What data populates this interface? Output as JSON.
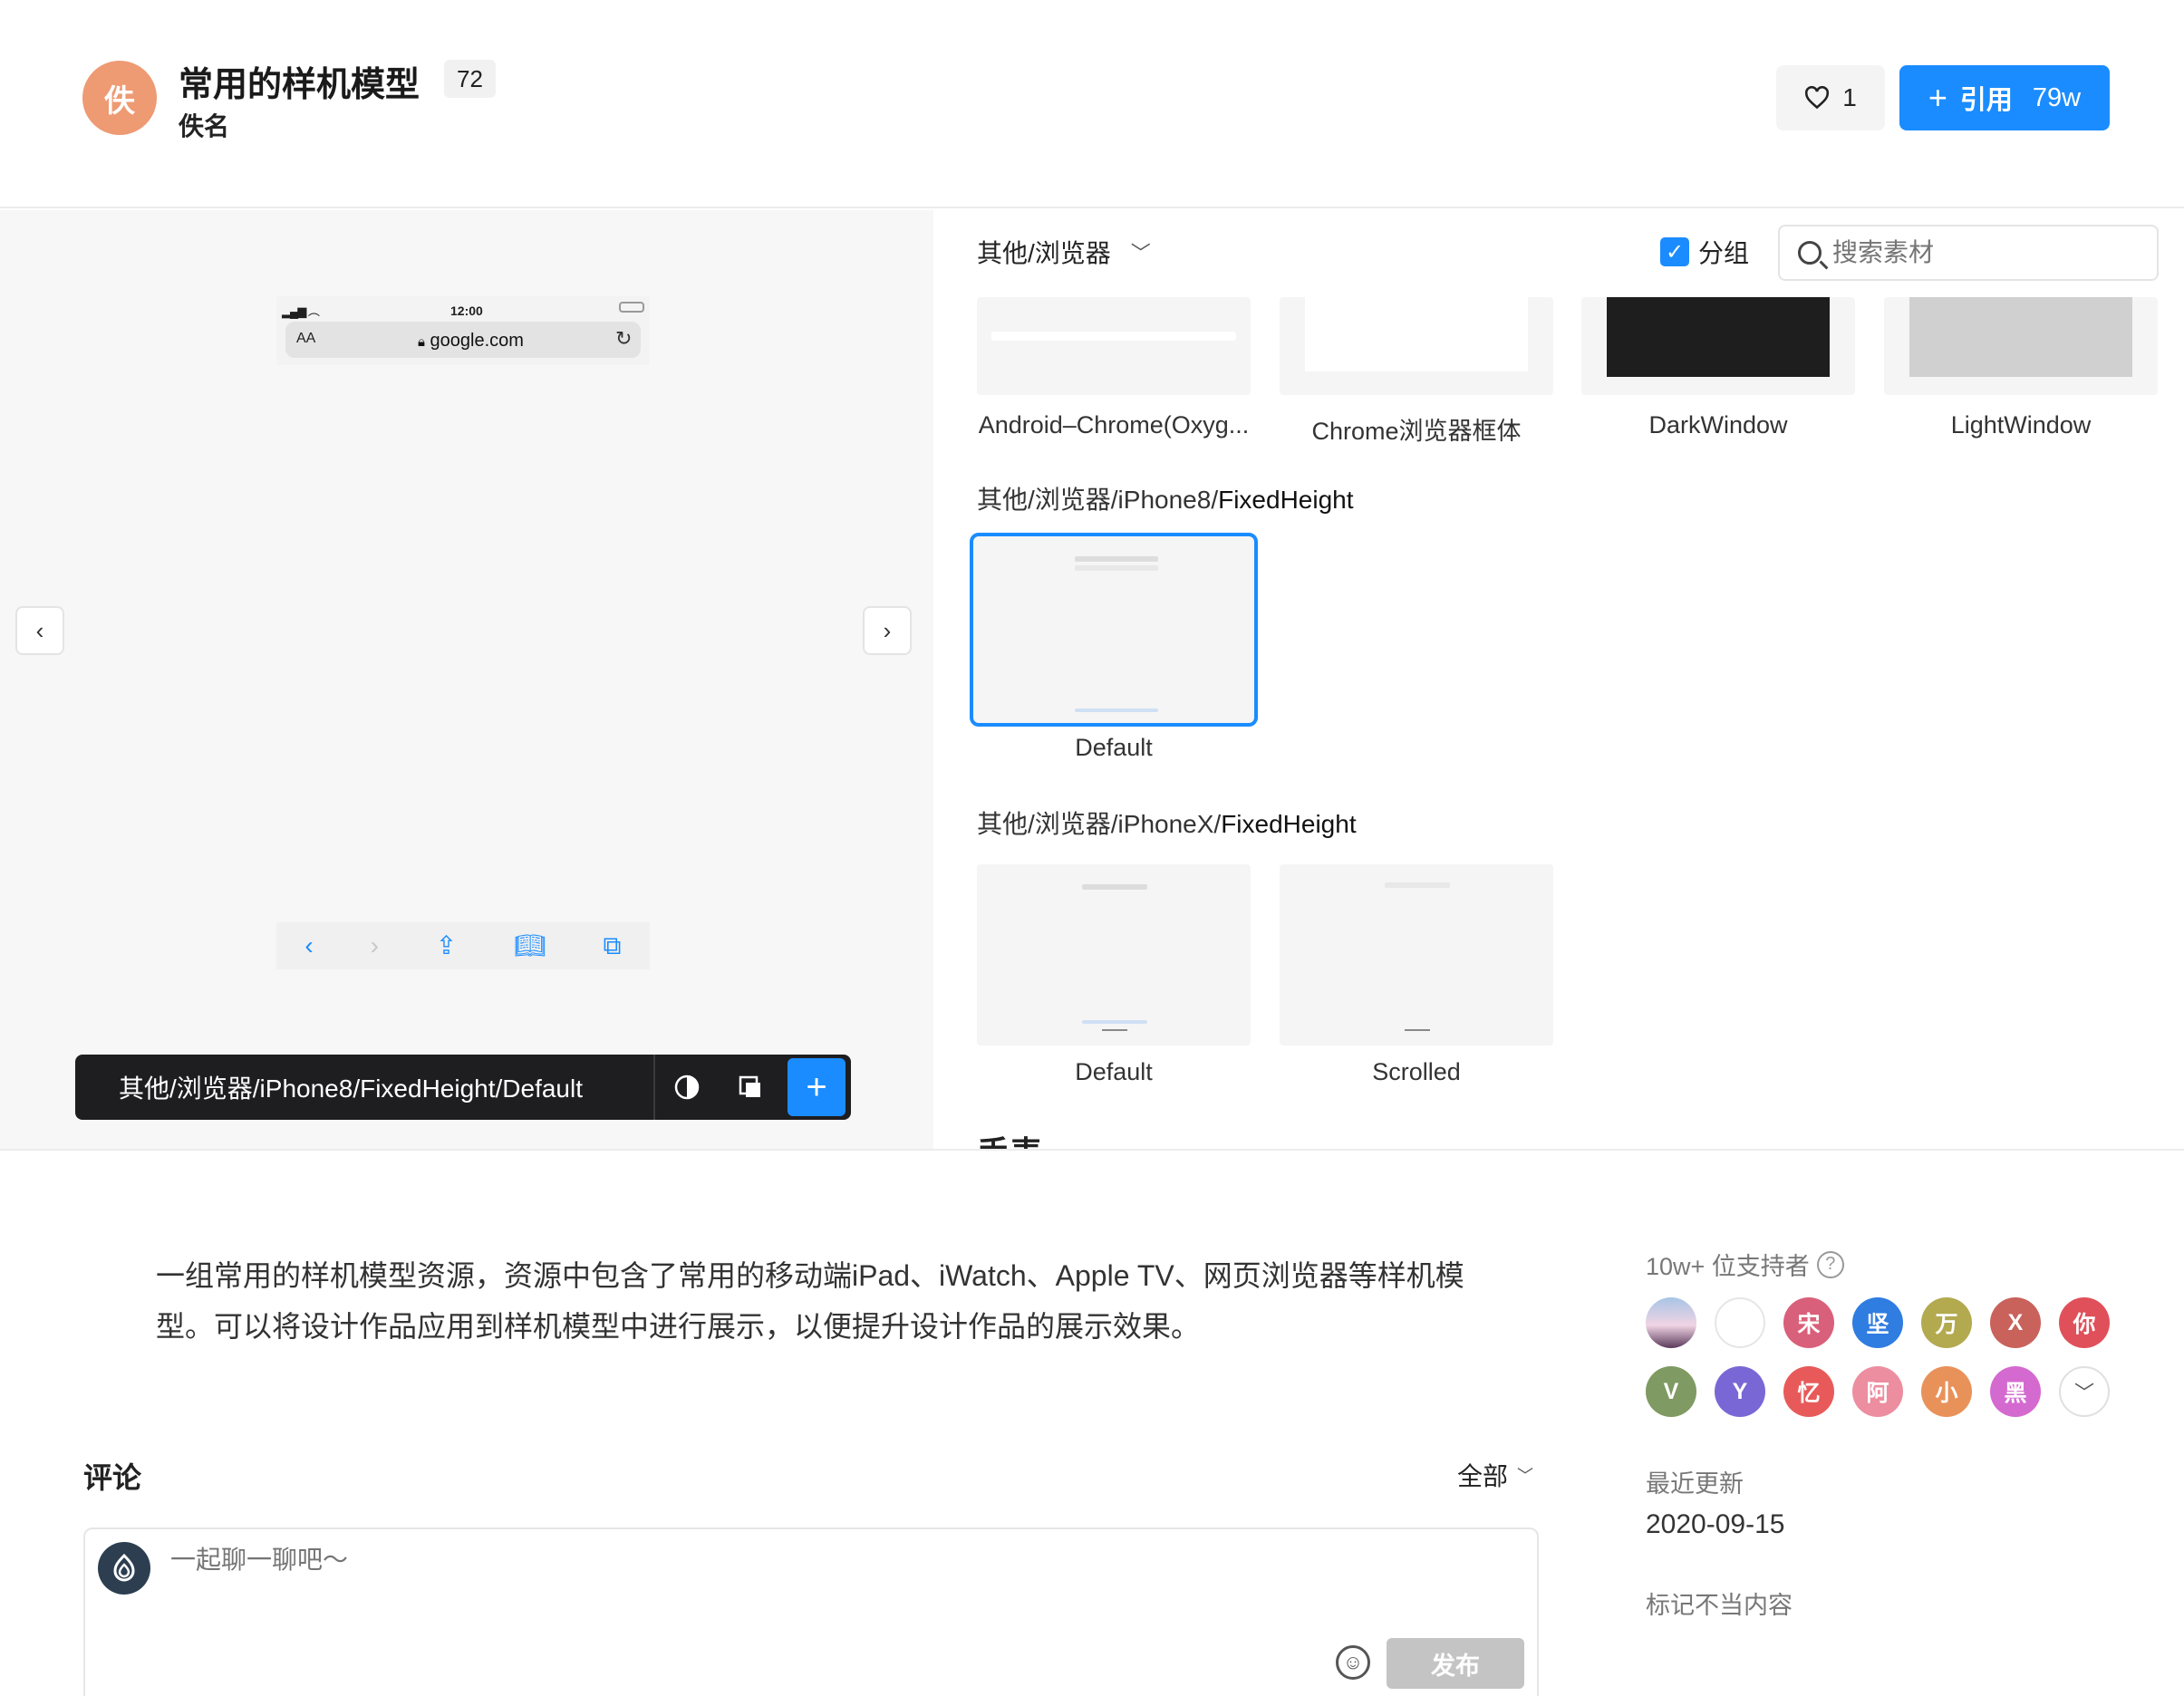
{
  "header": {
    "avatar_text": "佚",
    "title": "常用的样机模型",
    "badge": "72",
    "author": "佚名",
    "like_count": "1",
    "cite_label": "引用",
    "cite_count": "79w"
  },
  "preview": {
    "phone_time": "12:00",
    "phone_aa": "AA",
    "phone_url": "google.com",
    "path": "其他/浏览器/iPhone8/FixedHeight/Default"
  },
  "assets": {
    "category": "其他/浏览器",
    "group_label": "分组",
    "search_placeholder": "搜索素材",
    "top_row": [
      "Android–Chrome(Oxyg...",
      "Chrome浏览器框体",
      "DarkWindow",
      "LightWindow"
    ],
    "section1": {
      "prefix": "其他/浏览器/iPhone8/",
      "name": "FixedHeight",
      "items": [
        "Default"
      ]
    },
    "section2": {
      "prefix": "其他/浏览器/iPhoneX/",
      "name": "FixedHeight",
      "items": [
        "Default",
        "Scrolled"
      ]
    },
    "next_section": "手表"
  },
  "description": "一组常用的样机模型资源，资源中包含了常用的移动端iPad、iWatch、Apple TV、网页浏览器等样机模型。可以将设计作品应用到样机模型中进行展示，以便提升设计作品的展示效果。",
  "comments": {
    "title": "评论",
    "filter": "全部",
    "placeholder": "一起聊一聊吧～",
    "publish": "发布"
  },
  "sidebar": {
    "supporters_title": "10w+ 位支持者",
    "supporters": [
      {
        "text": "",
        "color": ""
      },
      {
        "text": "",
        "color": "#ffffff"
      },
      {
        "text": "宋",
        "color": "#d9607a"
      },
      {
        "text": "坚",
        "color": "#2f7de1"
      },
      {
        "text": "万",
        "color": "#b3a94f"
      },
      {
        "text": "X",
        "color": "#c9625b"
      },
      {
        "text": "你",
        "color": "#e0505a"
      },
      {
        "text": "V",
        "color": "#7f9a62"
      },
      {
        "text": "Y",
        "color": "#7a67d6"
      },
      {
        "text": "忆",
        "color": "#e85a5a"
      },
      {
        "text": "阿",
        "color": "#ec8ea0"
      },
      {
        "text": "小",
        "color": "#e8925a"
      },
      {
        "text": "黑",
        "color": "#d46ad0"
      }
    ],
    "updated_label": "最近更新",
    "updated_value": "2020-09-15",
    "report": "标记不当内容"
  },
  "colors": {
    "accent": "#1a8cff",
    "avatar": "#ee9a73"
  }
}
